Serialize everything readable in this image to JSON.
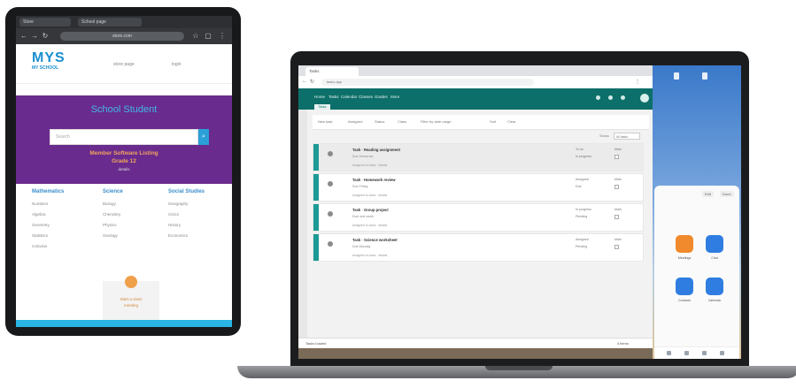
{
  "tablet": {
    "browser": {
      "tab1": "Store",
      "tab2": "School page",
      "url": "store.com"
    },
    "site": {
      "logo": "MYS",
      "logo_sub": "MY SCHOOL",
      "nav1": "store page",
      "nav2": "login"
    },
    "hero": {
      "title": "School Student",
      "search_placeholder": "Search",
      "line1": "Member Software Listing",
      "line2": "Grade 12",
      "line3": "details"
    },
    "columns": [
      {
        "head": "Mathematics",
        "items": [
          "Numbers",
          "Algebra",
          "Geometry",
          "Statistics",
          "Calculus"
        ]
      },
      {
        "head": "Science",
        "items": [
          "Biology",
          "Chemistry",
          "Physics",
          "Geology"
        ]
      },
      {
        "head": "Social Studies",
        "items": [
          "Geography",
          "Civics",
          "History",
          "Economics"
        ]
      }
    ],
    "card": {
      "line1": "Start a class",
      "line2": "meeting"
    }
  },
  "laptop": {
    "browser": {
      "tab": "Tasks",
      "url": "tasks.app"
    },
    "appbar": {
      "items": [
        "Home",
        "Tasks",
        "Calendar",
        "Classes",
        "Grades",
        "More"
      ]
    },
    "subtab": "Tasks",
    "toolbar": {
      "items": [
        "New task",
        "Assigned",
        "Status",
        "Class",
        "Filter by date range",
        "Sort",
        "Clear"
      ]
    },
    "filter_label": "Status",
    "filter_value": "All tasks",
    "tasks": [
      {
        "title": "Task · Reading assignment",
        "sub": "Due Tomorrow",
        "desc": "Assigned to class · details",
        "status1": "To do",
        "status2": "In progress",
        "col": "Mark"
      },
      {
        "title": "Task · Homework review",
        "sub": "Due Friday",
        "desc": "Assigned to class · details",
        "status1": "Assigned",
        "status2": "Due",
        "col": "Mark"
      },
      {
        "title": "Task · Group project",
        "sub": "Due next week",
        "desc": "Assigned to class · details",
        "status1": "In progress",
        "status2": "Pending",
        "col": "Mark"
      },
      {
        "title": "Task · Science worksheet",
        "sub": "Due Monday",
        "desc": "Assigned to class · details",
        "status1": "Assigned",
        "status2": "Pending",
        "col": "Mark"
      }
    ],
    "bottom": {
      "left": "Tasks loaded",
      "right": "4 items"
    },
    "phone": {
      "sheet_btn1": "Edit",
      "sheet_btn2": "Done",
      "apps": [
        "Meetings",
        "Chat",
        "Contacts",
        "Calendar"
      ]
    }
  },
  "colors": {
    "hero_purple": "#6a2b8e",
    "app_teal": "#0d6f6a",
    "accent_blue": "#1a8fd0",
    "orange": "#f0a04b"
  }
}
